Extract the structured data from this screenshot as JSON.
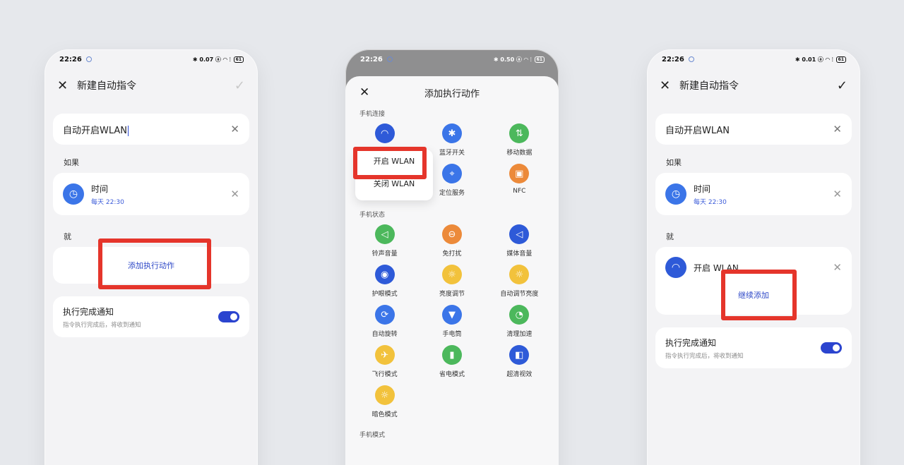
{
  "statusbar": {
    "time": "22:26",
    "right": "✱ 0.07 ▣ ◠ 𝄙 61",
    "right2": "✱ 0.50 ▣ ◠ 𝄙 61",
    "right3": "✱ 0.01 ▣ ◠ 𝄙 61",
    "battery": "61"
  },
  "screen1": {
    "title": "新建自动指令",
    "input_value": "自动开启WLAN",
    "if_label": "如果",
    "condition_title": "时间",
    "condition_sub": "每天 22:30",
    "then_label": "就",
    "add_action": "添加执行动作",
    "notify_title": "执行完成通知",
    "notify_sub": "指令执行完成后，将收到通知"
  },
  "screen2": {
    "title": "添加执行动作",
    "group1": "手机连接",
    "group2": "手机状态",
    "group3": "手机模式",
    "popup": [
      "开启 WLAN",
      "关闭 WLAN"
    ],
    "connect_items": [
      {
        "label": "蓝牙开关",
        "icon": "bluetooth-icon"
      },
      {
        "label": "移动数据",
        "icon": "mobile-data-icon"
      },
      {
        "label": "定位服务",
        "icon": "location-icon"
      },
      {
        "label": "NFC",
        "icon": "nfc-icon"
      }
    ],
    "state_items": [
      {
        "label": "铃声音量",
        "icon": "ringtone-volume-icon"
      },
      {
        "label": "免打扰",
        "icon": "do-not-disturb-icon"
      },
      {
        "label": "媒体音量",
        "icon": "media-volume-icon"
      },
      {
        "label": "护眼模式",
        "icon": "eye-care-icon"
      },
      {
        "label": "亮度调节",
        "icon": "brightness-icon"
      },
      {
        "label": "自动调节亮度",
        "icon": "auto-brightness-icon"
      },
      {
        "label": "自动旋转",
        "icon": "auto-rotate-icon"
      },
      {
        "label": "手电筒",
        "icon": "flashlight-icon"
      },
      {
        "label": "清理加速",
        "icon": "clean-boost-icon"
      },
      {
        "label": "飞行模式",
        "icon": "airplane-mode-icon"
      },
      {
        "label": "省电模式",
        "icon": "power-saving-icon"
      },
      {
        "label": "超清视效",
        "icon": "hd-visual-icon"
      },
      {
        "label": "暗色模式",
        "icon": "dark-mode-icon"
      }
    ]
  },
  "screen3": {
    "title": "新建自动指令",
    "input_value": "自动开启WLAN",
    "if_label": "如果",
    "condition_title": "时间",
    "condition_sub": "每天 22:30",
    "then_label": "就",
    "action_title": "开启 WLAN",
    "continue_add": "继续添加",
    "notify_title": "执行完成通知",
    "notify_sub": "指令执行完成后，将收到通知"
  },
  "colors": {
    "accent": "#2b44cf",
    "highlight_box": "#e5352b"
  }
}
